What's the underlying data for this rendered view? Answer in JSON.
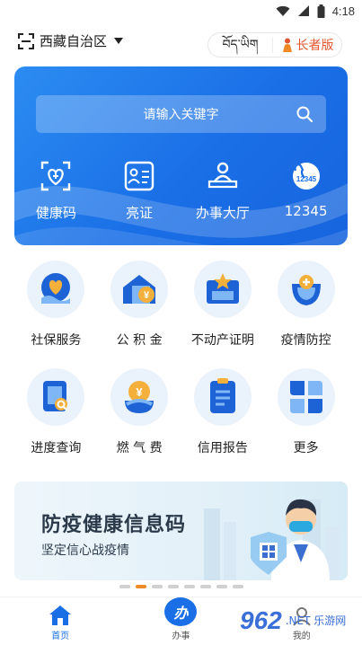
{
  "status_bar": {
    "time": "4:18"
  },
  "header": {
    "region": "西藏自治区",
    "tibetan_label": "བོད་ཡིག",
    "elder_mode": "长者版"
  },
  "banner": {
    "search_placeholder": "请输入关键字",
    "quick": [
      {
        "label": "健康码",
        "icon": "health-code-icon"
      },
      {
        "label": "亮证",
        "icon": "id-card-icon"
      },
      {
        "label": "办事大厅",
        "icon": "service-hall-icon"
      },
      {
        "label": "12345",
        "icon": "hotline-12345-icon"
      }
    ]
  },
  "services": [
    {
      "label": "社保服务",
      "icon": "social-security-icon"
    },
    {
      "label": "公 积 金",
      "icon": "housing-fund-icon"
    },
    {
      "label": "不动产证明",
      "icon": "real-estate-icon"
    },
    {
      "label": "疫情防控",
      "icon": "epidemic-control-icon"
    },
    {
      "label": "进度查询",
      "icon": "progress-query-icon"
    },
    {
      "label": "燃 气 费",
      "icon": "gas-fee-icon"
    },
    {
      "label": "信用报告",
      "icon": "credit-report-icon"
    },
    {
      "label": "更多",
      "icon": "more-icon"
    }
  ],
  "promo": {
    "title": "防疫健康信息码",
    "subtitle": "坚定信心战疫情"
  },
  "carousel": {
    "count": 8,
    "active_index": 1
  },
  "bottom_nav": {
    "home": "首页",
    "handle": "办事",
    "handle_glyph": "办",
    "mine": "我的"
  },
  "watermark": {
    "number": "962",
    "text": ".NET 乐游网"
  },
  "colors": {
    "primary": "#1a6fe6",
    "accent": "#f08a24",
    "elder": "#e4572e"
  }
}
